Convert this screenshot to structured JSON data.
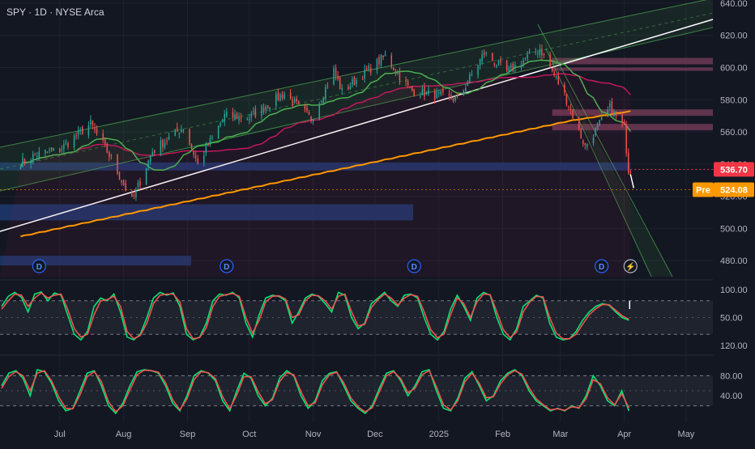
{
  "title": "SPY · 1D · NYSE Arca",
  "colors": {
    "bg": "#131722",
    "grid": "#1e2230",
    "axis_text": "#b2b5be",
    "up": "#26a69a",
    "down": "#ef5350",
    "ma_fast": "#4caf50",
    "ma_mid": "#c2185b",
    "ma_slow": "#ff9800",
    "channel": "#4caf50",
    "zone_blue": "#1e3a6e",
    "zone_pink": "#6d3a54",
    "last_price_bg": "#f23645",
    "pre_price_bg": "#ff9800",
    "stoch_k": "#00e676",
    "stoch_d": "#ef5350"
  },
  "chart_data": [
    {
      "type": "candlestick",
      "title": "SPY · 1D · NYSE Arca",
      "y_ticks": [
        480,
        500,
        520,
        540,
        560,
        580,
        600,
        620,
        640
      ],
      "ylim": [
        470,
        642
      ],
      "x_ticks": [
        "Jul",
        "Aug",
        "Sep",
        "Oct",
        "Nov",
        "Dec",
        "2025",
        "Feb",
        "Mar",
        "Apr",
        "May"
      ],
      "x_tick_dates": [
        "2024-07-01",
        "2024-08-01",
        "2024-09-01",
        "2024-10-01",
        "2024-11-01",
        "2024-12-01",
        "2025-01-01",
        "2025-02-01",
        "2025-03-01",
        "2025-04-01",
        "2025-05-01"
      ],
      "first_date": "2024-06-12",
      "last_date": "2025-04-04",
      "close_anchors": [
        {
          "date": "2024-06-12",
          "close": 541
        },
        {
          "date": "2024-06-20",
          "close": 546
        },
        {
          "date": "2024-07-01",
          "close": 549
        },
        {
          "date": "2024-07-16",
          "close": 565
        },
        {
          "date": "2024-07-24",
          "close": 548
        },
        {
          "date": "2024-08-05",
          "close": 517
        },
        {
          "date": "2024-08-15",
          "close": 548
        },
        {
          "date": "2024-08-30",
          "close": 563
        },
        {
          "date": "2024-09-06",
          "close": 540
        },
        {
          "date": "2024-09-19",
          "close": 570
        },
        {
          "date": "2024-10-01",
          "close": 569
        },
        {
          "date": "2024-10-18",
          "close": 584
        },
        {
          "date": "2024-10-31",
          "close": 568
        },
        {
          "date": "2024-11-11",
          "close": 598
        },
        {
          "date": "2024-11-15",
          "close": 585
        },
        {
          "date": "2024-12-06",
          "close": 607
        },
        {
          "date": "2024-12-18",
          "close": 586
        },
        {
          "date": "2025-01-10",
          "close": 580
        },
        {
          "date": "2025-01-23",
          "close": 609
        },
        {
          "date": "2025-02-03",
          "close": 597
        },
        {
          "date": "2025-02-19",
          "close": 612
        },
        {
          "date": "2025-03-03",
          "close": 583
        },
        {
          "date": "2025-03-13",
          "close": 551
        },
        {
          "date": "2025-03-25",
          "close": 575
        },
        {
          "date": "2025-04-01",
          "close": 562
        },
        {
          "date": "2025-04-03",
          "close": 536.7
        },
        {
          "date": "2025-04-04",
          "close": 536.7
        }
      ],
      "moving_averages": [
        {
          "name": "",
          "color": "#4caf50",
          "period": 20
        },
        {
          "name": "",
          "color": "#c2185b",
          "period": 50
        },
        {
          "name": "",
          "color": "#ff9800",
          "period": 200
        }
      ],
      "horizontal_zones": [
        {
          "from": 536,
          "to": 541,
          "color": "blue"
        },
        {
          "from": 505,
          "to": 515,
          "color": "blue"
        },
        {
          "from": 477,
          "to": 483,
          "color": "blue"
        },
        {
          "from": 602,
          "to": 606,
          "color": "pink"
        },
        {
          "from": 598,
          "to": 600,
          "color": "pink"
        },
        {
          "from": 570,
          "to": 574,
          "color": "pink"
        },
        {
          "from": 561,
          "to": 565,
          "color": "pink"
        }
      ],
      "dividend_marker_label": "D",
      "dividend_dates": [
        "2024-06-21",
        "2024-09-20",
        "2024-12-20",
        "2025-03-21"
      ],
      "event_marker_label": "⚡",
      "event_date": "2025-04-04",
      "last_price_label": "536.70",
      "pre_label": "Pre",
      "pre_price_label": "524.08",
      "pre_price": 524.08
    },
    {
      "type": "line",
      "name": "",
      "y_ticks": [
        "100.00",
        "50.00",
        "120.00"
      ],
      "ylim": [
        0,
        100
      ],
      "band": [
        20,
        80
      ],
      "series": [
        {
          "name": "",
          "color": "#00e676",
          "values": [
            70,
            88,
            95,
            86,
            60,
            92,
            96,
            80,
            94,
            90,
            55,
            20,
            10,
            25,
            70,
            85,
            80,
            92,
            60,
            15,
            10,
            20,
            50,
            85,
            95,
            90,
            94,
            70,
            20,
            10,
            15,
            40,
            80,
            92,
            90,
            95,
            85,
            40,
            15,
            55,
            85,
            90,
            88,
            80,
            40,
            60,
            85,
            92,
            88,
            75,
            60,
            95,
            90,
            50,
            30,
            40,
            75,
            85,
            95,
            80,
            70,
            90,
            92,
            85,
            50,
            20,
            10,
            25,
            65,
            90,
            70,
            45,
            85,
            95,
            90,
            50,
            20,
            10,
            30,
            70,
            80,
            90,
            85,
            40,
            15,
            10,
            12,
            25,
            45,
            60,
            70,
            75,
            72,
            60,
            50,
            45
          ]
        },
        {
          "name": "",
          "color": "#ef5350",
          "values": [
            65,
            80,
            92,
            90,
            70,
            85,
            94,
            85,
            90,
            92,
            65,
            30,
            15,
            20,
            55,
            80,
            82,
            88,
            70,
            25,
            12,
            18,
            40,
            75,
            90,
            92,
            92,
            78,
            30,
            12,
            14,
            32,
            70,
            88,
            91,
            93,
            88,
            50,
            22,
            45,
            78,
            88,
            89,
            83,
            50,
            55,
            80,
            90,
            89,
            80,
            65,
            88,
            92,
            60,
            35,
            38,
            68,
            82,
            92,
            85,
            72,
            85,
            91,
            88,
            60,
            28,
            14,
            20,
            55,
            85,
            75,
            50,
            78,
            92,
            91,
            60,
            28,
            14,
            24,
            60,
            78,
            88,
            87,
            50,
            22,
            12,
            12,
            20,
            38,
            55,
            66,
            73,
            73,
            63,
            53,
            47
          ]
        }
      ]
    },
    {
      "type": "line",
      "name": "",
      "y_ticks": [
        "80.00",
        "40.00"
      ],
      "ylim": [
        0,
        100
      ],
      "band": [
        20,
        80
      ],
      "series": [
        {
          "name": "",
          "color": "#00e676",
          "values": [
            60,
            85,
            90,
            75,
            40,
            92,
            88,
            65,
            30,
            10,
            15,
            50,
            85,
            90,
            60,
            20,
            5,
            25,
            60,
            88,
            92,
            90,
            85,
            60,
            25,
            10,
            40,
            80,
            90,
            85,
            70,
            30,
            10,
            50,
            85,
            75,
            40,
            20,
            35,
            75,
            90,
            80,
            40,
            15,
            30,
            70,
            85,
            88,
            60,
            30,
            15,
            5,
            20,
            55,
            85,
            90,
            70,
            40,
            60,
            88,
            92,
            50,
            15,
            10,
            35,
            75,
            88,
            60,
            30,
            40,
            70,
            85,
            92,
            80,
            50,
            30,
            20,
            10,
            15,
            10,
            20,
            15,
            40,
            80,
            60,
            30,
            20,
            50,
            10
          ]
        },
        {
          "name": "",
          "color": "#ef5350",
          "values": [
            55,
            78,
            88,
            80,
            50,
            85,
            90,
            70,
            38,
            15,
            14,
            42,
            78,
            88,
            68,
            28,
            8,
            20,
            52,
            82,
            91,
            90,
            87,
            66,
            32,
            12,
            34,
            72,
            88,
            86,
            74,
            38,
            14,
            42,
            78,
            78,
            48,
            24,
            32,
            68,
            86,
            82,
            48,
            20,
            26,
            62,
            82,
            87,
            66,
            36,
            18,
            8,
            16,
            48,
            80,
            88,
            74,
            46,
            55,
            82,
            90,
            58,
            22,
            12,
            30,
            68,
            85,
            65,
            36,
            38,
            64,
            82,
            90,
            83,
            56,
            34,
            22,
            12,
            14,
            11,
            18,
            16,
            34,
            72,
            64,
            36,
            22,
            44,
            16
          ]
        }
      ]
    }
  ]
}
